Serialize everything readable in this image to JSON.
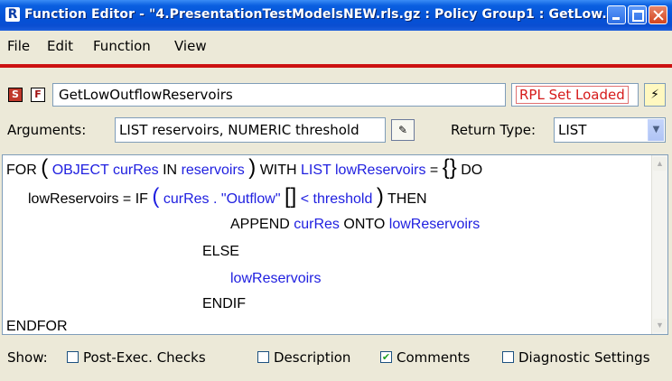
{
  "window": {
    "title": "Function Editor - \"4.PresentationTestModelsNEW.rls.gz : Policy Group1 : GetLow..."
  },
  "menu": {
    "items": [
      "File",
      "Edit",
      "Function",
      "View"
    ]
  },
  "function": {
    "name": "GetLowOutflowReservoirs",
    "status": "RPL Set Loaded",
    "arguments_label": "Arguments:",
    "arguments_value": "LIST reservoirs, NUMERIC threshold",
    "return_type_label": "Return Type:",
    "return_type_value": "LIST"
  },
  "code": {
    "line1": {
      "for": "FOR",
      "object": "OBJECT",
      "cur": "curRes",
      "in": "IN",
      "res": "reservoirs",
      "with": "WITH",
      "list": "LIST",
      "low": "lowReservoirs",
      "eq": "=",
      "do": "DO"
    },
    "line2": {
      "low": "lowReservoirs",
      "eq": "=",
      "if": "IF",
      "cur": "curRes",
      "dot": ".",
      "slot": "\"Outflow\"",
      "lt": "<",
      "thr": "threshold",
      "then": "THEN"
    },
    "line3": {
      "append": "APPEND",
      "cur": "curRes",
      "onto": "ONTO",
      "low": "lowReservoirs"
    },
    "else": "ELSE",
    "line5": "lowReservoirs",
    "endif": "ENDIF",
    "endfor": "ENDFOR"
  },
  "show": {
    "label": "Show:",
    "options": [
      {
        "label": "Post-Exec. Checks",
        "checked": false
      },
      {
        "label": "Description",
        "checked": false
      },
      {
        "label": "Comments",
        "checked": true
      },
      {
        "label": "Diagnostic Settings",
        "checked": false
      }
    ]
  }
}
